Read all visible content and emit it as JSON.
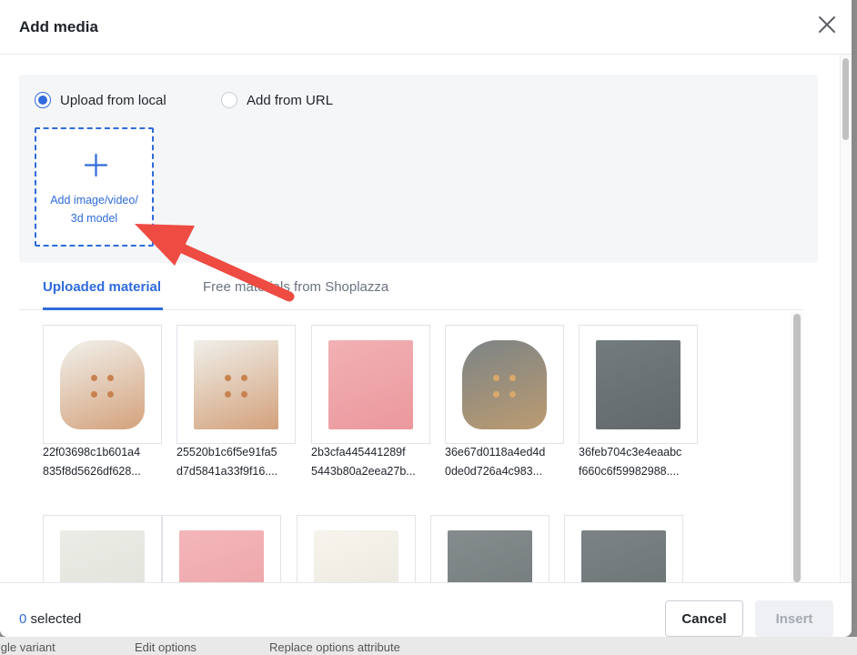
{
  "modal": {
    "title": "Add media",
    "close_icon": "close-icon"
  },
  "upload_source": {
    "options": [
      {
        "label": "Upload from local",
        "selected": true
      },
      {
        "label": "Add from URL",
        "selected": false
      }
    ]
  },
  "add_box": {
    "line1": "Add image/video/",
    "line2": "3d model",
    "icon": "plus-icon"
  },
  "tabs": [
    {
      "label": "Uploaded material",
      "active": true
    },
    {
      "label": "Free materials from Shoplazza",
      "active": false
    }
  ],
  "materials": [
    {
      "line1": "22f03698c1b601a4",
      "line2": "835f8d5626df628...",
      "color": "#f1f1ec",
      "accent": "#c8824f"
    },
    {
      "line1": "25520b1c6f5e91fa5",
      "line2": "d7d5841a33f9f16....",
      "color": "#efefea",
      "accent": "#c8824f"
    },
    {
      "line1": "2b3cfa445441289f",
      "line2": "5443b80a2eea27b...",
      "color": "#f1b1b4",
      "accent": "#e98e94"
    },
    {
      "line1": "36e67d0118a4ed4d",
      "line2": "0de0d726a4c983...",
      "color": "#7c8486",
      "accent": "#d5a468"
    },
    {
      "line1": "36feb704c3e4eaabc",
      "line2": "f660c6f59982988....",
      "color": "#737b7d",
      "accent": "#5b6264"
    },
    {
      "line1": "",
      "line2": "",
      "color": "#ecece6",
      "accent": "#dcdcd5"
    },
    {
      "line1": "",
      "line2": "",
      "color": "#f3b6b9",
      "accent": "#ea9aa0"
    },
    {
      "line1": "",
      "line2": "",
      "color": "#f6f4ec",
      "accent": "#e4e1d6"
    },
    {
      "line1": "",
      "line2": "",
      "color": "#858c8d",
      "accent": "#6a7172"
    },
    {
      "line1": "",
      "line2": "",
      "color": "#7b8385",
      "accent": "#636a6c"
    }
  ],
  "footer": {
    "count": "0",
    "selected_label": "selected",
    "cancel_label": "Cancel",
    "insert_label": "Insert"
  },
  "backdrop": {
    "item1": "Single variant",
    "item2": "Edit options",
    "item3": "Replace options attribute"
  },
  "colors": {
    "accent": "#2f6bdc",
    "annotation_arrow": "#ee4b43"
  }
}
